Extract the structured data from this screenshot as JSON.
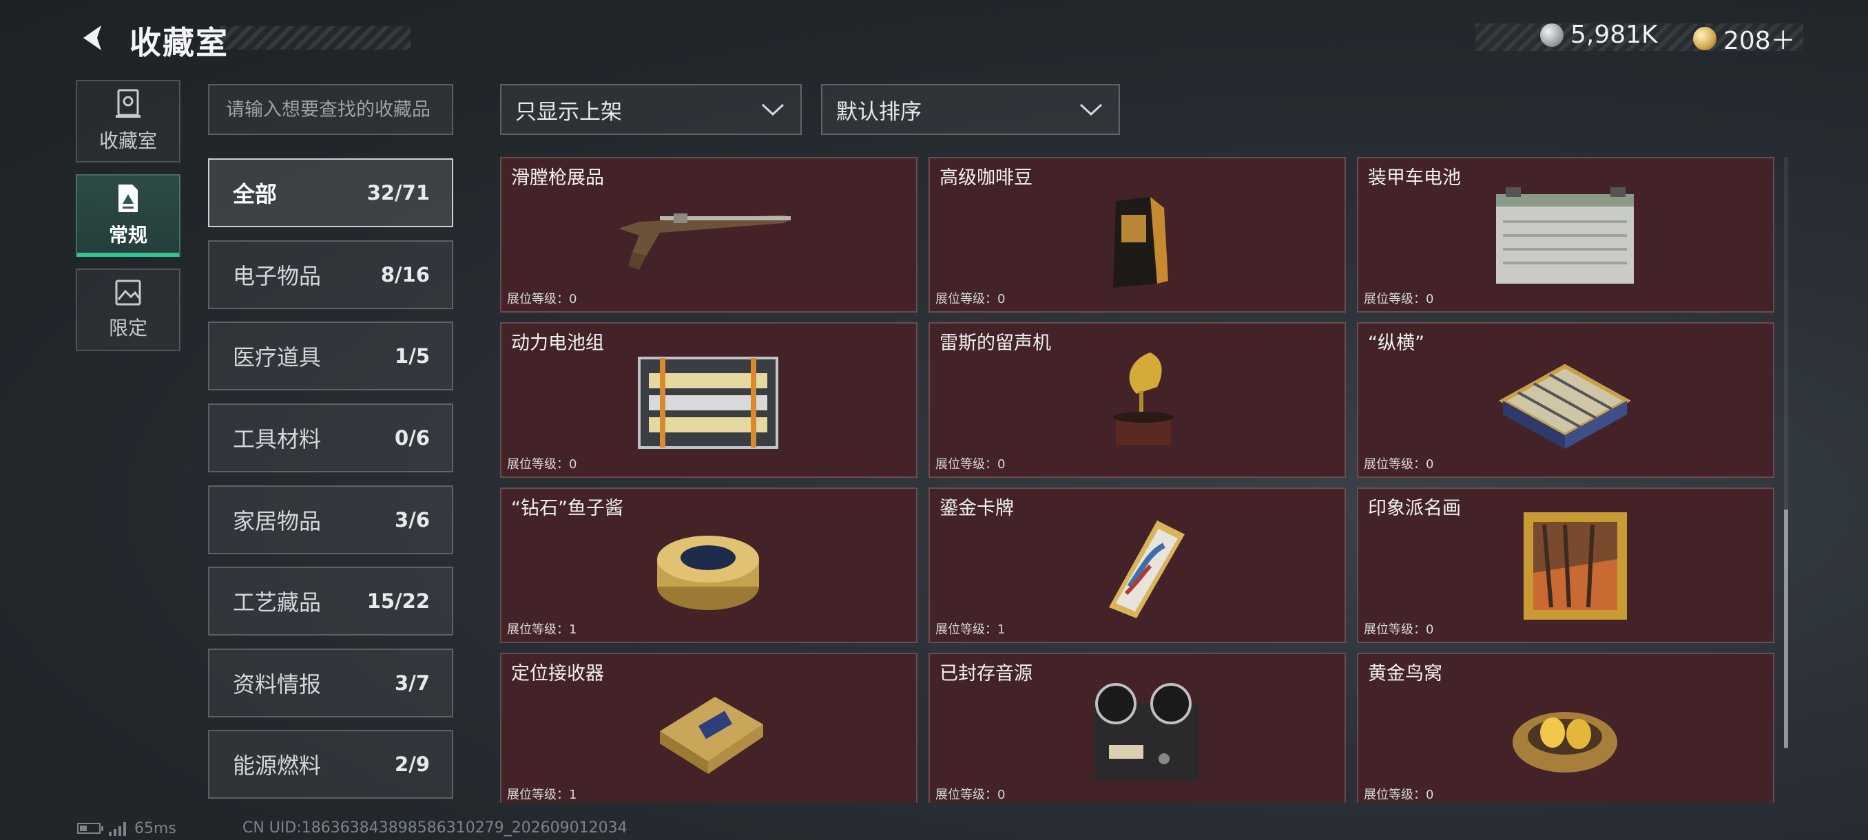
{
  "header": {
    "title": "收藏室",
    "currency_silver": "5,981K",
    "currency_gold": "208＋"
  },
  "nav": [
    {
      "label": "收藏室",
      "icon": "collection-room-icon"
    },
    {
      "label": "常规",
      "icon": "regular-document-icon",
      "active": true
    },
    {
      "label": "限定",
      "icon": "limited-image-icon"
    }
  ],
  "search": {
    "placeholder": "请输入想要查找的收藏品",
    "value": ""
  },
  "filters": {
    "display": "只显示上架",
    "sort": "默认排序"
  },
  "categories": [
    {
      "label": "全部",
      "count": "32/71",
      "active": true
    },
    {
      "label": "电子物品",
      "count": "8/16"
    },
    {
      "label": "医疗道具",
      "count": "1/5"
    },
    {
      "label": "工具材料",
      "count": "0/6"
    },
    {
      "label": "家居物品",
      "count": "3/6"
    },
    {
      "label": "工艺藏品",
      "count": "15/22"
    },
    {
      "label": "资料情报",
      "count": "3/7"
    },
    {
      "label": "能源燃料",
      "count": "2/9"
    }
  ],
  "items": [
    {
      "name": "滑膛枪展品",
      "level": "展位等级：0",
      "icon": "musket-icon"
    },
    {
      "name": "高级咖啡豆",
      "level": "展位等级：0",
      "icon": "coffee-bag-icon"
    },
    {
      "name": "装甲车电池",
      "level": "展位等级：0",
      "icon": "vehicle-battery-icon"
    },
    {
      "name": "动力电池组",
      "level": "展位等级：0",
      "icon": "battery-pack-icon"
    },
    {
      "name": "雷斯的留声机",
      "level": "展位等级：0",
      "icon": "gramophone-icon"
    },
    {
      "name": "“纵横”",
      "level": "展位等级：0",
      "icon": "chess-board-icon"
    },
    {
      "name": "“钻石”鱼子酱",
      "level": "展位等级：1",
      "icon": "caviar-tin-icon"
    },
    {
      "name": "鎏金卡牌",
      "level": "展位等级：1",
      "icon": "gilded-card-icon"
    },
    {
      "name": "印象派名画",
      "level": "展位等级：0",
      "icon": "framed-painting-icon"
    },
    {
      "name": "定位接收器",
      "level": "展位等级：1",
      "icon": "locator-receiver-icon"
    },
    {
      "name": "已封存音源",
      "level": "展位等级：0",
      "icon": "reel-tape-recorder-icon"
    },
    {
      "name": "黄金鸟窝",
      "level": "展位等级：0",
      "icon": "golden-nest-icon"
    }
  ],
  "footer": {
    "ping": "65ms",
    "uid": "CN UID:18636384389858631027​9_202609012034"
  },
  "colors": {
    "card_bg": "#442328",
    "accent_green": "#34c38c",
    "background": "#2b3137"
  }
}
